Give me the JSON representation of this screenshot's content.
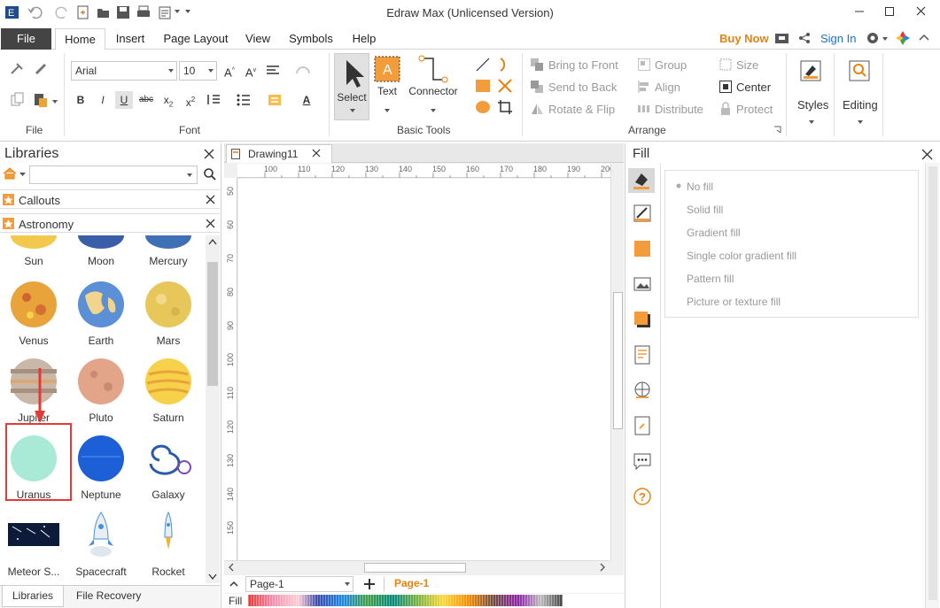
{
  "window": {
    "title": "Edraw Max (Unlicensed Version)",
    "buy_now": "Buy Now",
    "sign_in": "Sign In"
  },
  "tabs": [
    "File",
    "Home",
    "Insert",
    "Page Layout",
    "View",
    "Symbols",
    "Help"
  ],
  "ribbon": {
    "file_group": "File",
    "font": {
      "family": "Arial",
      "size": "10",
      "group": "Font"
    },
    "basic_tools": {
      "select": "Select",
      "text": "Text",
      "connector": "Connector",
      "group": "Basic Tools"
    },
    "arrange": {
      "bring_front": "Bring to Front",
      "send_back": "Send to Back",
      "rotate_flip": "Rotate & Flip",
      "group_btn": "Group",
      "align": "Align",
      "distribute": "Distribute",
      "size": "Size",
      "center": "Center",
      "protect": "Protect",
      "group": "Arrange"
    },
    "styles": "Styles",
    "editing": "Editing"
  },
  "libraries": {
    "title": "Libraries",
    "sections": [
      "Callouts",
      "Astronomy"
    ],
    "items": [
      {
        "label": "Sun",
        "color": "#f2c94c"
      },
      {
        "label": "Moon",
        "color": "#3a5fa8"
      },
      {
        "label": "Mercury",
        "color": "#3f6fb5"
      },
      {
        "label": "Venus",
        "color": "#e8a33b"
      },
      {
        "label": "Earth",
        "color": "#5b8fd6"
      },
      {
        "label": "Mars",
        "color": "#e8c75a"
      },
      {
        "label": "Jupiter",
        "color": "#c9b8a8"
      },
      {
        "label": "Pluto",
        "color": "#e2a58a"
      },
      {
        "label": "Saturn",
        "color": "#f7d14a"
      },
      {
        "label": "Uranus",
        "color": "#a8ead6"
      },
      {
        "label": "Neptune",
        "color": "#1d5fd6"
      },
      {
        "label": "Galaxy",
        "color": "#2a5ba6"
      },
      {
        "label": "Meteor S...",
        "color": "#0d1a3a"
      },
      {
        "label": "Spacecraft",
        "color": "#4a90d9"
      },
      {
        "label": "Rocket",
        "color": "#f0b030"
      }
    ],
    "bottom_tabs": [
      "Libraries",
      "File Recovery"
    ]
  },
  "document": {
    "tab": "Drawing11",
    "ruler_h": [
      "100",
      "110",
      "120",
      "130",
      "140",
      "150",
      "160",
      "170",
      "180",
      "190",
      "200"
    ],
    "ruler_v": [
      "50",
      "60",
      "70",
      "80",
      "90",
      "100",
      "110",
      "120",
      "130",
      "140",
      "150"
    ],
    "page_select": "Page-1",
    "active_page": "Page-1",
    "fill_label": "Fill"
  },
  "fill_panel": {
    "title": "Fill",
    "options": [
      "No fill",
      "Solid fill",
      "Gradient fill",
      "Single color gradient fill",
      "Pattern fill",
      "Picture or texture fill"
    ]
  },
  "colors": {
    "accent": "#e8820c",
    "file_tab": "#444444",
    "highlight": "#e53935"
  }
}
